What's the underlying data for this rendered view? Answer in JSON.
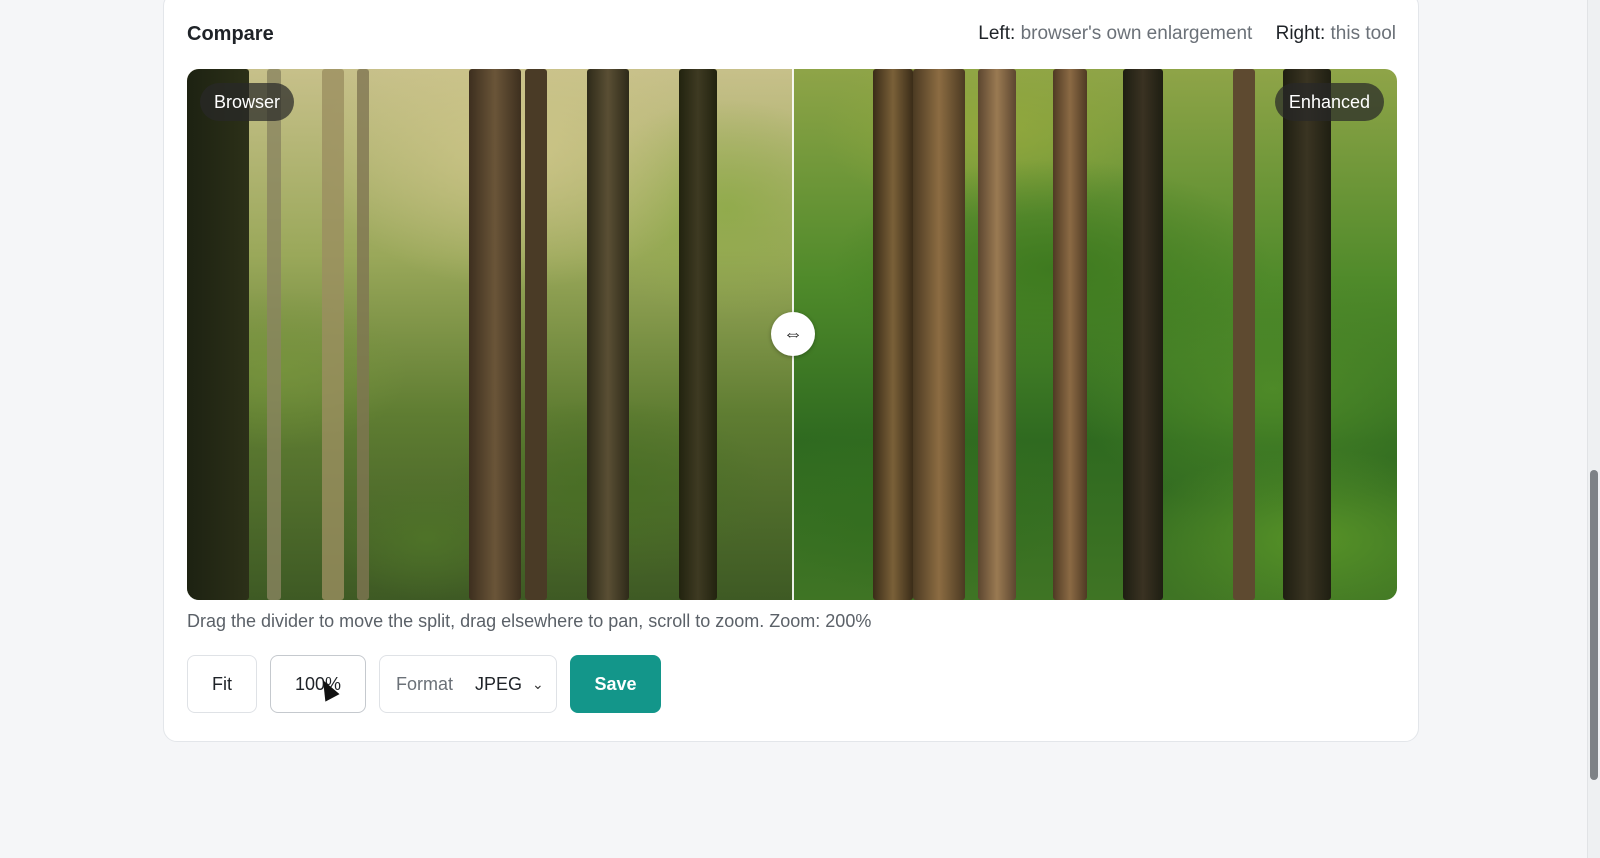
{
  "card": {
    "title": "Compare",
    "legend": {
      "left_key": "Left:",
      "left_text": "browser's own enlargement",
      "right_key": "Right:",
      "right_text": "this tool"
    }
  },
  "viewer": {
    "left_tag": "Browser",
    "right_tag": "Enhanced",
    "handle_glyph": "⇔",
    "split_position_percent": 50
  },
  "hint": "Drag the divider to move the split, drag elsewhere to pan, scroll to zoom. Zoom: 200%",
  "controls": {
    "fit_label": "Fit",
    "zoom_label": "100%",
    "format_label": "Format",
    "format_value": "JPEG",
    "chevron": "⌄",
    "save_label": "Save"
  },
  "colors": {
    "accent": "#13968a",
    "page_bg": "#f5f6f8",
    "card_bg": "#ffffff"
  },
  "icons": {
    "handle": "split-handle-icon",
    "chevron": "chevron-down-icon",
    "cursor": "mouse-pointer-icon"
  }
}
